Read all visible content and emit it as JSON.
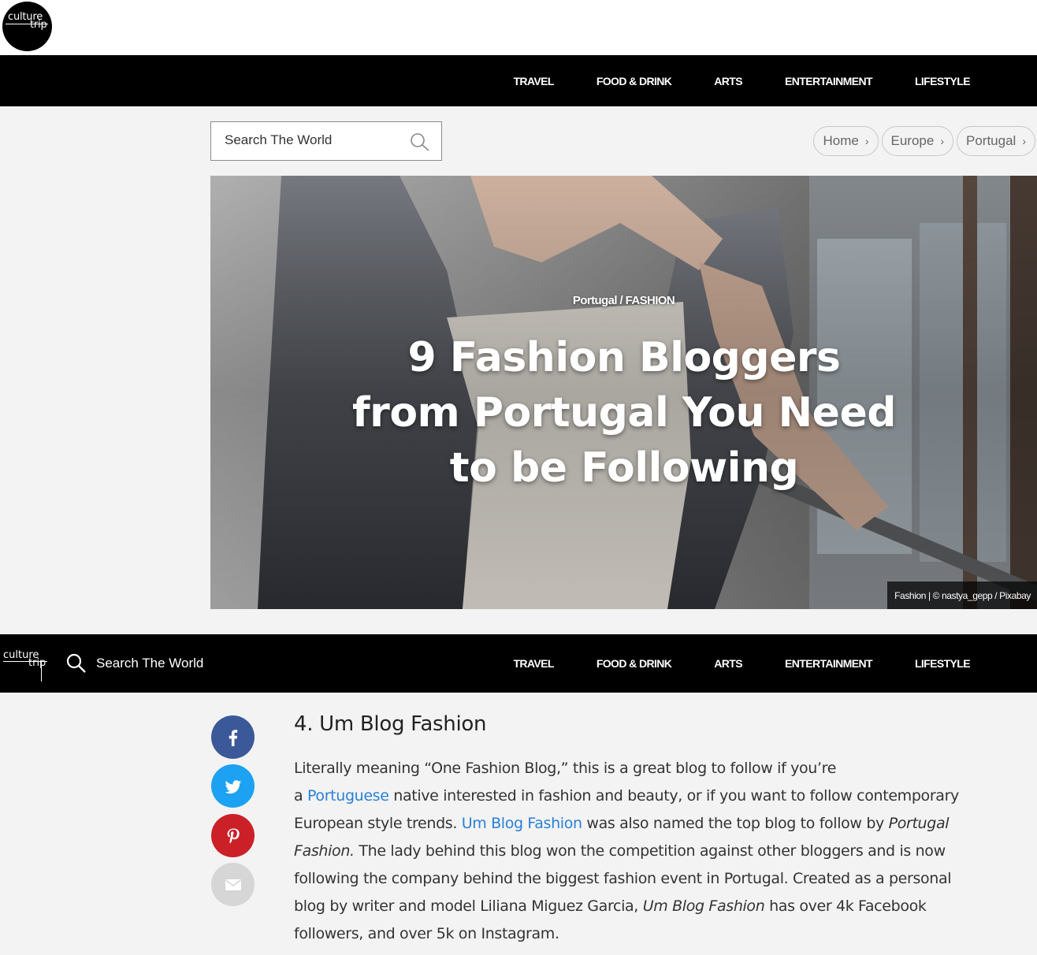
{
  "brand": {
    "logo_line1": "culture",
    "logo_line2": "trip"
  },
  "nav": [
    "TRAVEL",
    "FOOD & DRINK",
    "ARTS",
    "ENTERTAINMENT",
    "LIFESTYLE"
  ],
  "search": {
    "placeholder": "Search The World"
  },
  "breadcrumb": [
    "Home",
    "Europe",
    "Portugal"
  ],
  "hero": {
    "category": "Portugal / FASHION",
    "title": "9 Fashion Bloggers from Portugal You Need to be Following",
    "credit": "Fashion | © nastya_gepp / Pixabay"
  },
  "sticky": {
    "search_label": "Search The World"
  },
  "share": [
    "facebook",
    "twitter",
    "pinterest",
    "email"
  ],
  "article": {
    "heading": "4. Um Blog Fashion",
    "p1": "Literally meaning “One Fashion Blog,” this is a great blog to follow if you’re",
    "p2a": " a ",
    "link1": "Portuguese",
    "p2b": " native interested in fashion and beauty, or if you want to follow contemporary European style trends. ",
    "link2": "Um Blog Fashion",
    "p3": " was also named the top blog to follow by ",
    "em1": "Portugal Fashion.",
    "p4": " The lady behind this blog won the competition against other bloggers and is now following the company behind the biggest fashion event in Portugal. Created as a personal blog by writer and model Liliana Miguez Garcia, ",
    "em2": "Um Blog Fashion",
    "p5": " has over 4k Facebook followers, and over 5k on Instagram."
  },
  "colors": {
    "facebook": "#3b5998",
    "twitter": "#1da1f2",
    "pinterest": "#cb2027",
    "email": "#d6d6d6",
    "link": "#2a7fd9"
  }
}
